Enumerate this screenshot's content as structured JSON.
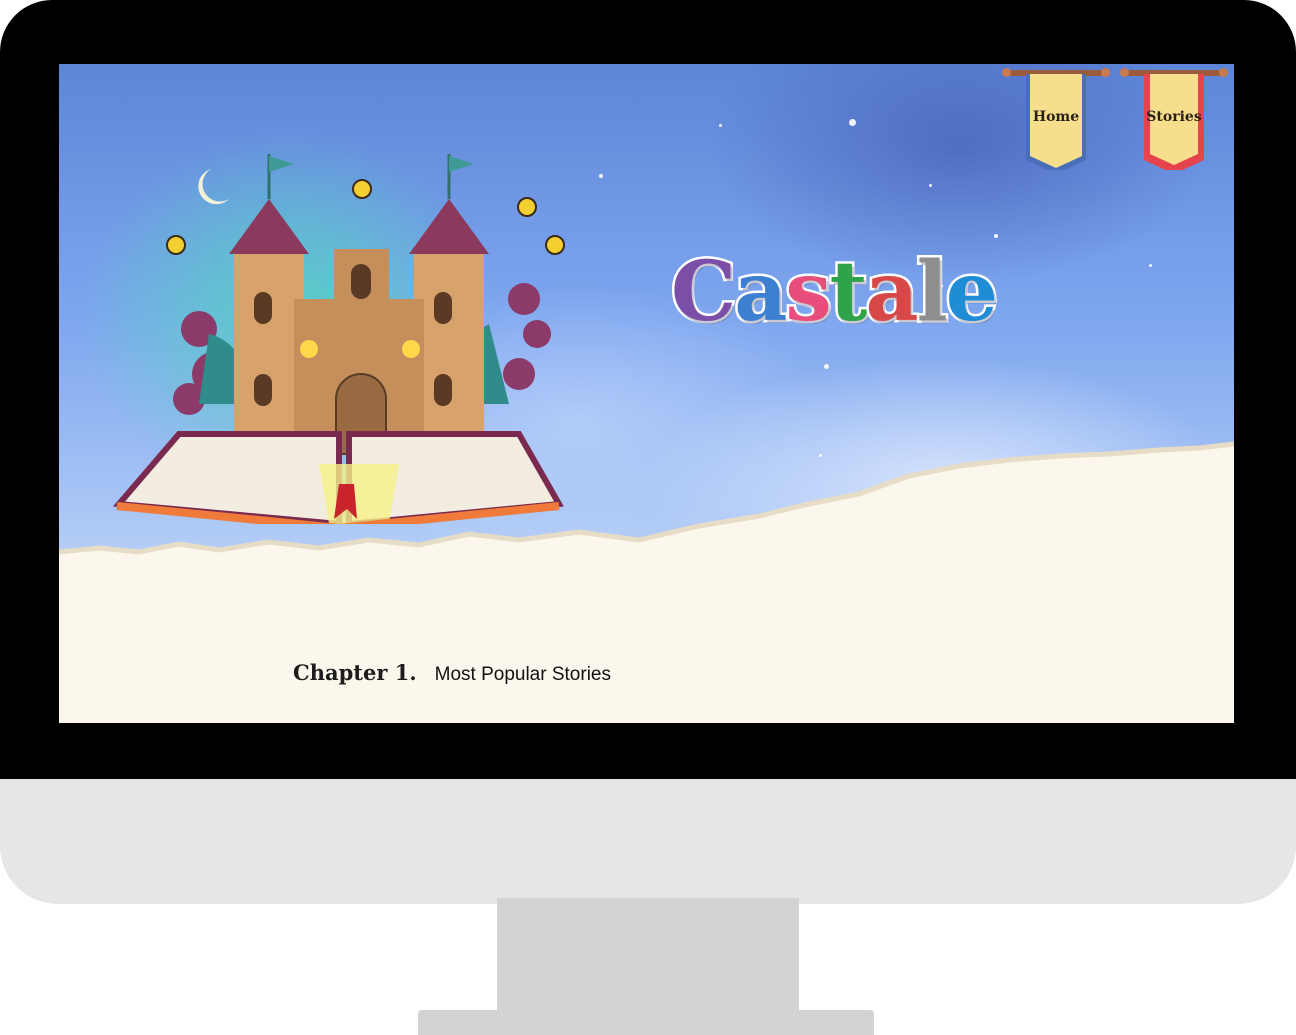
{
  "nav": {
    "home_label": "Home",
    "stories_label": "Stories"
  },
  "hero": {
    "logo_letters": [
      {
        "char": "C",
        "color": "#7b4fa8"
      },
      {
        "char": "a",
        "color": "#3d7fd1"
      },
      {
        "char": "s",
        "color": "#e84d7b"
      },
      {
        "char": "t",
        "color": "#2fa34a"
      },
      {
        "char": "a",
        "color": "#d94848"
      },
      {
        "char": "l",
        "color": "#8e8e8e"
      },
      {
        "char": "e",
        "color": "#1f8dd6"
      }
    ]
  },
  "chapter": {
    "number": "Chapter 1.",
    "title": "Most Popular Stories"
  },
  "colors": {
    "paper": "#fcf7ec",
    "banner_home": "#f7de8c",
    "banner_stories": "#e7434f"
  }
}
